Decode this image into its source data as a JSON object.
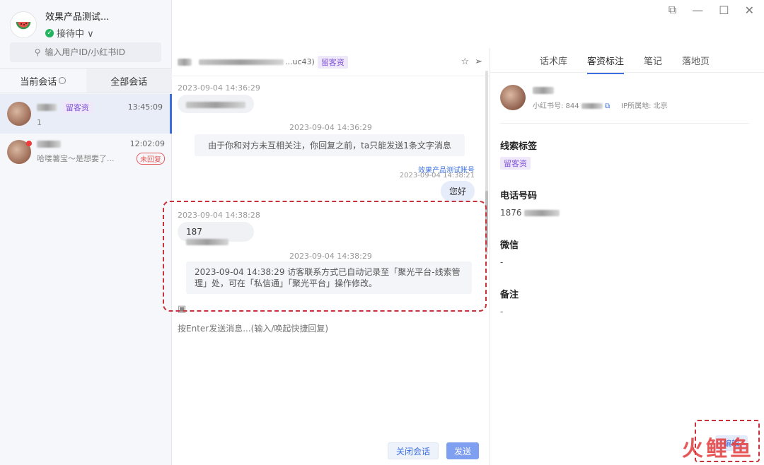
{
  "window": {
    "controls": [
      "⧉",
      "—",
      "☐",
      "✕"
    ]
  },
  "brand": {
    "name": "效果产品测试...",
    "status": "接待中 ∨"
  },
  "search": {
    "placeholder": "输入用户ID/小红书ID"
  },
  "tabs": {
    "current": "当前会话",
    "all": "全部会话"
  },
  "conversations": [
    {
      "tag": "留客资",
      "time": "13:45:09",
      "preview": "1"
    },
    {
      "time": "12:02:09",
      "preview": "哈喽薯宝～是想要了...",
      "badge": "未回复"
    }
  ],
  "chat": {
    "header_suffix": "...uc43)",
    "header_tag": "留客资",
    "messages": [
      {
        "time": "2023-09-04 14:36:29"
      },
      {
        "time": "2023-09-04 14:36:29",
        "system": "由于你和对方未互相关注，你回复之前，ta只能发送1条文字消息"
      },
      {
        "sender": "效果产品测试账号",
        "time": "2023-09-04 14:38:21",
        "text": "您好"
      },
      {
        "time": "2023-09-04 14:38:28",
        "text": "187"
      },
      {
        "time": "2023-09-04 14:38:29",
        "system": "2023-09-04 14:38:29 访客联系方式已自动记录至「聚光平台-线索管理」处，可在「私信通」「聚光平台」操作修改。"
      }
    ],
    "composer_placeholder": "按Enter发送消息...(输入/唤起快捷回复)",
    "close_label": "关闭会话",
    "send_label": "发送"
  },
  "right": {
    "tabs": [
      "话术库",
      "客资标注",
      "笔记",
      "落地页"
    ],
    "profile": {
      "id_label": "小红书号: 844",
      "ip": "IP所属地: 北京"
    },
    "sections": [
      {
        "title": "线索标签",
        "value": "留客资"
      },
      {
        "title": "电话号码",
        "value": "1876"
      },
      {
        "title": "微信",
        "value": "-"
      },
      {
        "title": "备注",
        "value": "-"
      }
    ],
    "edit_label": "编辑"
  },
  "watermark": "火鲤鱼"
}
